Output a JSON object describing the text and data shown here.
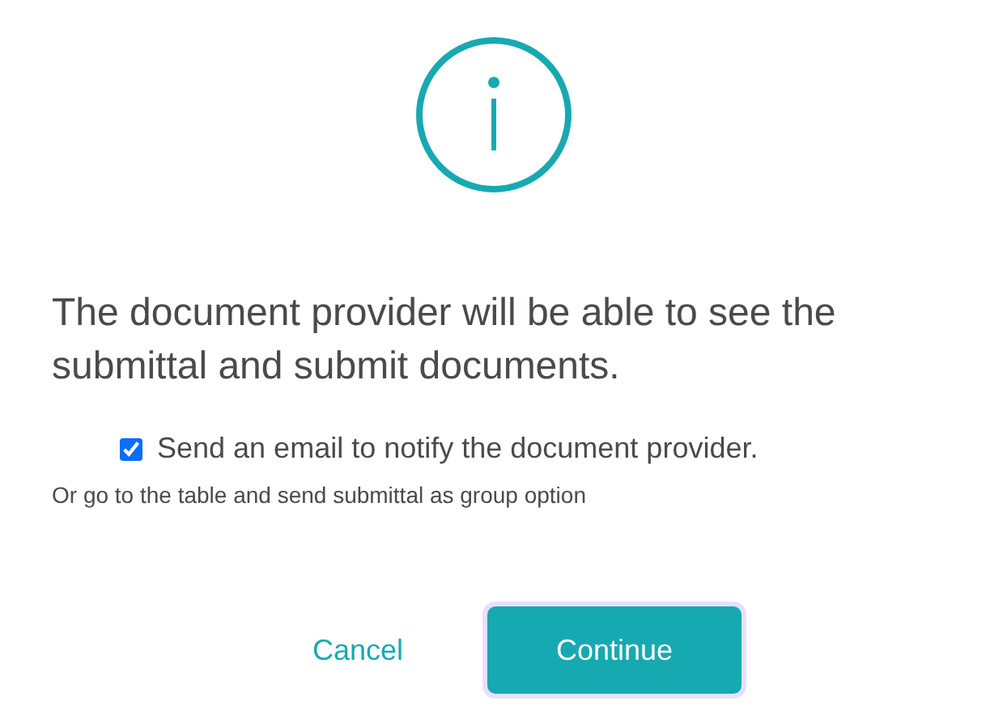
{
  "message": "The document provider will be able to see the submittal and submit documents.",
  "notify": {
    "label": "Send an email to notify the document provider.",
    "checked": true
  },
  "hint": "Or go to the table and send submittal as group option",
  "buttons": [
    {
      "label": "Cancel",
      "kind": "link"
    },
    {
      "label": "Continue",
      "kind": "primary"
    }
  ]
}
